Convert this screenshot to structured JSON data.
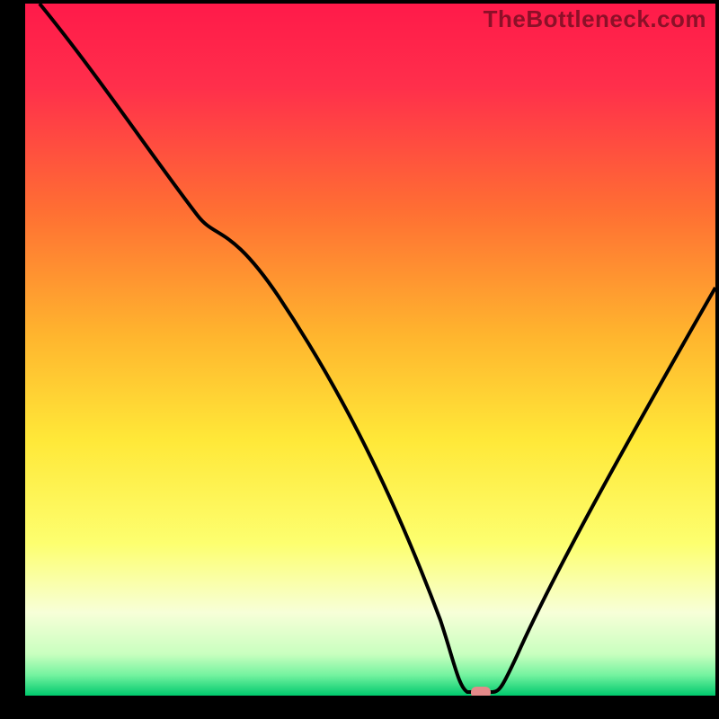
{
  "watermark": "TheBottleneck.com",
  "chart_data": {
    "type": "line",
    "title": "",
    "xlabel": "",
    "ylabel": "",
    "xlim": [
      0,
      100
    ],
    "ylim": [
      0,
      100
    ],
    "grid": false,
    "legend": false,
    "gradient_colors": {
      "top": "#ff1a4a",
      "upper_mid": "#ff8a2a",
      "mid": "#ffe838",
      "lower_mid": "#f7ff9c",
      "bottom": "#00e07a"
    },
    "marker": {
      "x": 64,
      "y": 0,
      "color": "#e48a8a"
    },
    "x": [
      0,
      6,
      12,
      18,
      24,
      30,
      36,
      42,
      48,
      54,
      60,
      63,
      66,
      70,
      74,
      80,
      86,
      92,
      100
    ],
    "values": [
      100,
      92,
      85,
      77,
      70,
      68,
      59,
      49,
      38,
      26,
      10,
      1,
      0,
      1,
      9,
      22,
      36,
      48,
      62
    ],
    "series": [
      {
        "name": "bottleneck-curve",
        "x": [
          0,
          6,
          12,
          18,
          24,
          30,
          36,
          42,
          48,
          54,
          60,
          63,
          66,
          70,
          74,
          80,
          86,
          92,
          100
        ],
        "y": [
          100,
          92,
          85,
          77,
          70,
          68,
          59,
          49,
          38,
          26,
          10,
          1,
          0,
          1,
          9,
          22,
          36,
          48,
          62
        ]
      }
    ]
  }
}
